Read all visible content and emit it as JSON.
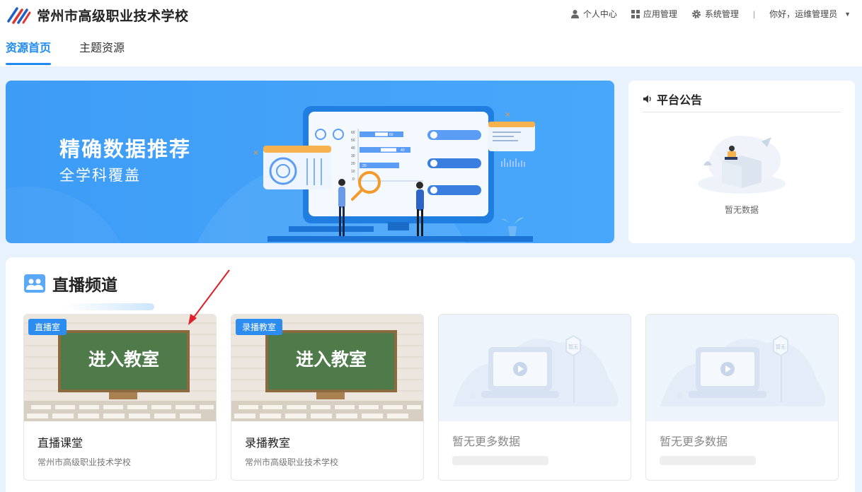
{
  "header": {
    "school_name": "常州市高级职业技术学校",
    "nav": [
      {
        "label": "个人中心",
        "icon": "user-icon"
      },
      {
        "label": "应用管理",
        "icon": "grid-icon"
      },
      {
        "label": "系统管理",
        "icon": "gear-icon"
      }
    ],
    "divider": "|",
    "greeting": "你好，运维管理员"
  },
  "tabs": [
    {
      "label": "资源首页",
      "active": true
    },
    {
      "label": "主题资源",
      "active": false
    }
  ],
  "banner": {
    "title": "精确数据推荐",
    "subtitle": "全学科覆盖",
    "art_labels": {
      "a": "60",
      "b": "40",
      "c": "20",
      "ticks": [
        "60",
        "50",
        "40",
        "30",
        "20",
        "10",
        "0"
      ]
    }
  },
  "notice": {
    "title": "平台公告",
    "empty_text": "暂无数据"
  },
  "live": {
    "title": "直播频道",
    "cards": [
      {
        "badge": "直播室",
        "board_text": "进入教室",
        "title": "直播课堂",
        "subtitle": "常州市高级职业技术学校"
      },
      {
        "badge": "录播教室",
        "board_text": "进入教室",
        "title": "录播教室",
        "subtitle": "常州市高级职业技术学校"
      },
      {
        "empty_text": "暂无更多数据",
        "sign_text": "暂无"
      },
      {
        "empty_text": "暂无更多数据",
        "sign_text": "暂无"
      }
    ]
  },
  "colors": {
    "accent": "#1f8bf0",
    "badge": "#2d8cf0",
    "banner": "#3d9cf6"
  }
}
